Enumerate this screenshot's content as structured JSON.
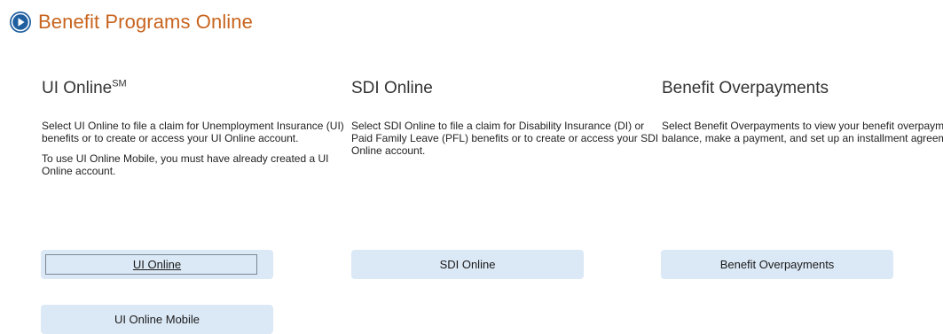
{
  "header": {
    "title": "Benefit Programs Online",
    "icon": "play-circle-icon",
    "accent_color": "#c8641e",
    "icon_color": "#1f5fa0"
  },
  "columns": [
    {
      "title": "UI Online",
      "title_sup": "SM",
      "paragraphs": [
        "Select UI Online to file a claim for Unemployment Insurance (UI) benefits or to create or access your UI Online account.",
        "To use UI Online Mobile, you must have already created a UI Online account."
      ],
      "buttons": [
        "UI Online",
        "UI Online Mobile"
      ]
    },
    {
      "title": "SDI Online",
      "paragraphs": [
        "Select SDI Online to file a claim for Disability Insurance (DI) or Paid Family Leave (PFL) benefits or to create or access your SDI Online account."
      ],
      "buttons": [
        "SDI Online"
      ]
    },
    {
      "title": "Benefit Overpayments",
      "paragraphs": [
        "Select Benefit Overpayments to view your benefit overpayment balance, make a payment, and set up an installment agreement."
      ],
      "buttons": [
        "Benefit Overpayments"
      ]
    }
  ],
  "colors": {
    "button_bg": "#dbe8f5",
    "highlight": "#fbf61c"
  }
}
